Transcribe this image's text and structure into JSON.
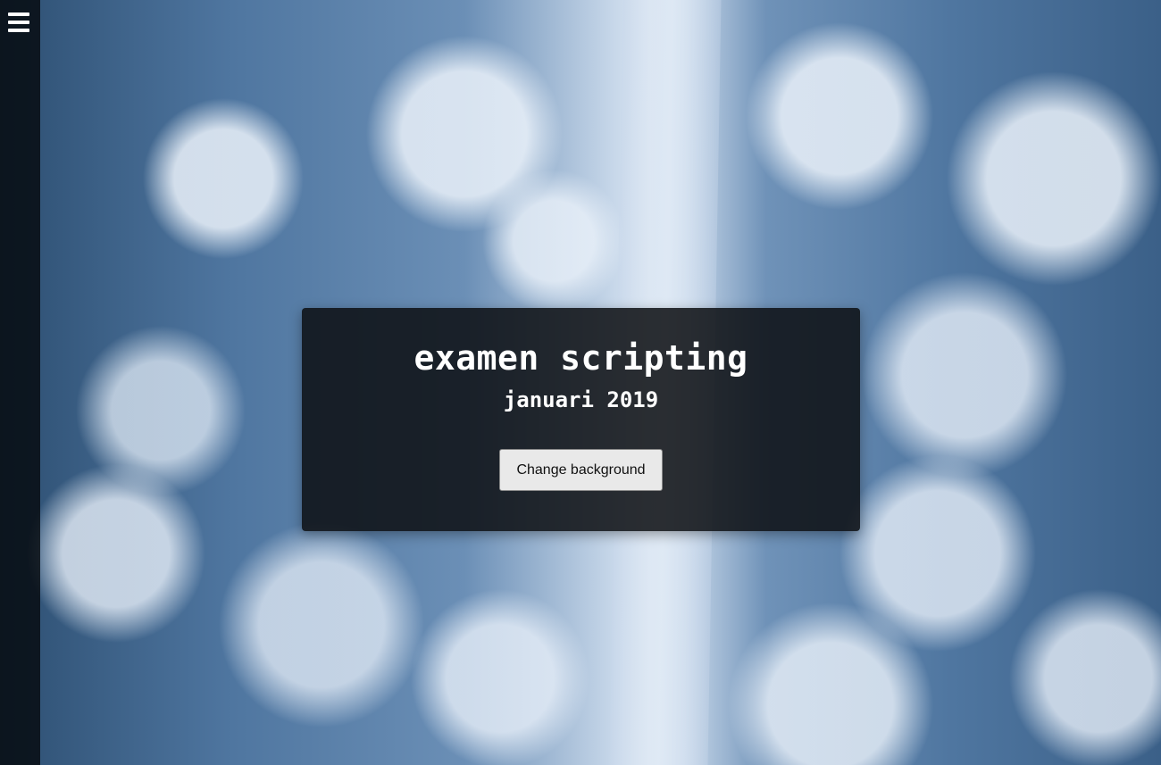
{
  "background": {
    "description_icon": "snowy-forest-photo"
  },
  "sidebar": {
    "menu_icon": "hamburger-menu-icon"
  },
  "card": {
    "title": "examen scripting",
    "subtitle": "januari 2019",
    "button_label": "Change background"
  },
  "colors": {
    "card_background": "#0c0e12",
    "button_background": "#e9e9e9",
    "text": "#ffffff"
  }
}
